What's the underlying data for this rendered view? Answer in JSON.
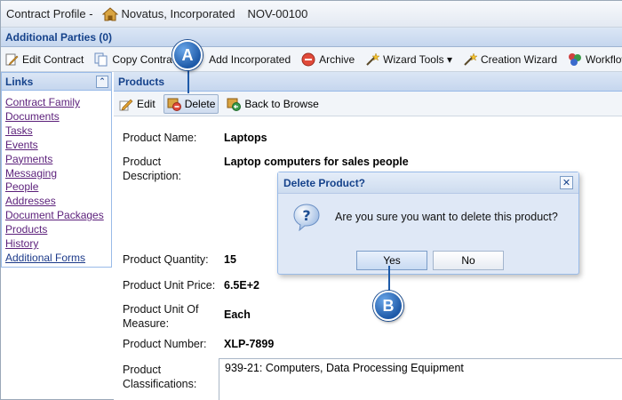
{
  "title_bar": {
    "label": "Contract Profile -",
    "company": "Novatus, Incorporated",
    "contract_id": "NOV-00100"
  },
  "parties": {
    "label": "Additional Parties (0)"
  },
  "toolbar": {
    "items": [
      {
        "label": "Edit Contract",
        "icon": "edit-document-icon"
      },
      {
        "label": "Copy Contract",
        "icon": "copy-icon"
      },
      {
        "label": "Add Incorporated",
        "icon": "add-icon"
      },
      {
        "label": "Archive",
        "icon": "archive-icon"
      },
      {
        "label": "Wizard Tools ▾",
        "icon": "wand-icon"
      },
      {
        "label": "Creation Wizard",
        "icon": "wand-icon"
      },
      {
        "label": "Workflows",
        "icon": "workflow-icon"
      }
    ]
  },
  "links": {
    "title": "Links",
    "items": [
      "Contract Family",
      "Documents",
      "Tasks",
      "Events",
      "Payments",
      "Messaging",
      "People",
      "Addresses",
      "Document Packages",
      "Products",
      "History",
      "Additional Forms"
    ]
  },
  "products": {
    "title": "Products",
    "toolbar": {
      "edit": "Edit",
      "delete": "Delete",
      "back": "Back to Browse"
    },
    "fields": {
      "name_label": "Product Name:",
      "name_value": "Laptops",
      "desc_label_1": "Product",
      "desc_label_2": "Description:",
      "desc_value": "Laptop computers for sales people",
      "qty_label": "Product Quantity:",
      "qty_value": "15",
      "price_label": "Product Unit Price:",
      "price_value": "6.5E+2",
      "uom_label_1": "Product Unit Of",
      "uom_label_2": "Measure:",
      "uom_value": "Each",
      "number_label": "Product Number:",
      "number_value": "XLP-7899",
      "class_label_1": "Product",
      "class_label_2": "Classifications:",
      "class_value": "939-21: Computers, Data Processing Equipment"
    }
  },
  "dialog": {
    "title": "Delete Product?",
    "message": "Are you sure you want to delete this product?",
    "yes": "Yes",
    "no": "No"
  },
  "callouts": {
    "a": "A",
    "b": "B"
  },
  "colors": {
    "accent": "#15428b",
    "link": "#5b1f7a",
    "callout": "#1e5aa8"
  }
}
